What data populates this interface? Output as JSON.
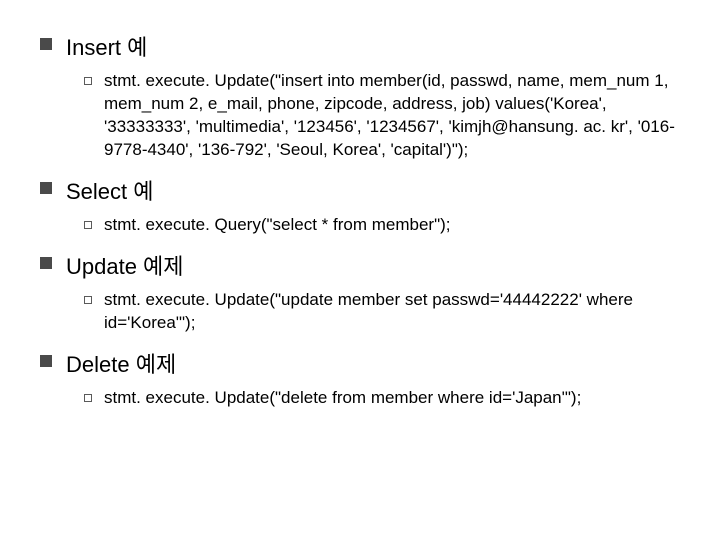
{
  "sections": [
    {
      "title": "Insert 예",
      "items": [
        "stmt. execute. Update(\"insert into member(id, passwd, name, mem_num 1, mem_num 2, e_mail, phone, zipcode, address, job) values('Korea', '33333333', 'multimedia', '123456', '1234567', 'kimjh@hansung. ac. kr', '016-9778-4340', '136-792', 'Seoul, Korea', 'capital')\");"
      ]
    },
    {
      "title": "Select 예",
      "items": [
        "stmt. execute. Query(\"select * from member\");"
      ]
    },
    {
      "title": "Update 예제",
      "items": [
        "stmt. execute. Update(\"update member set passwd='44442222' where id='Korea'\");"
      ]
    },
    {
      "title": "Delete 예제",
      "items": [
        "stmt. execute. Update(\"delete from member where id='Japan'\");"
      ]
    }
  ]
}
